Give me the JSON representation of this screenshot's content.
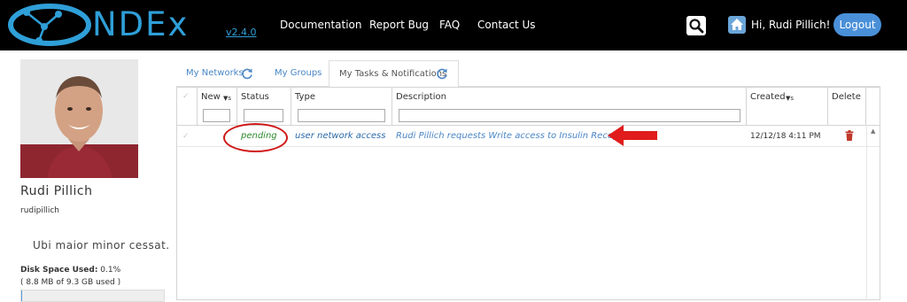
{
  "header": {
    "logo_text": "NDEx",
    "version": "v2.4.0",
    "nav": [
      "Documentation",
      "Report Bug",
      "FAQ",
      "Contact Us"
    ],
    "greeting": "Hi, Rudi Pillich!",
    "logout_label": "Logout"
  },
  "profile": {
    "name": "Rudi Pillich",
    "username": "rudipillich",
    "motto": "Ubi maior minor cessat.",
    "disk_label": "Disk Space Used:",
    "disk_percent": "0.1%",
    "disk_detail": "( 8.8 MB of 9.3 GB used )",
    "disk_fraction": 0.001
  },
  "tabs": [
    {
      "label": "My Networks"
    },
    {
      "label": "My Groups"
    },
    {
      "label": "My Tasks & Notifications"
    }
  ],
  "grid": {
    "columns": [
      "New",
      "Status",
      "Type",
      "Description",
      "Created",
      "Delete"
    ],
    "rows": [
      {
        "status": "pending",
        "type": "user network access",
        "description": "Rudi Pillich requests Write access to Insulin Receptor",
        "created": "12/12/18 4:11 PM"
      }
    ]
  },
  "colors": {
    "brand": "#2f9fd8",
    "navbar": "#000000",
    "status_pending": "#2e8b2e",
    "link": "#4a86c5",
    "annotation": "#d01818"
  }
}
